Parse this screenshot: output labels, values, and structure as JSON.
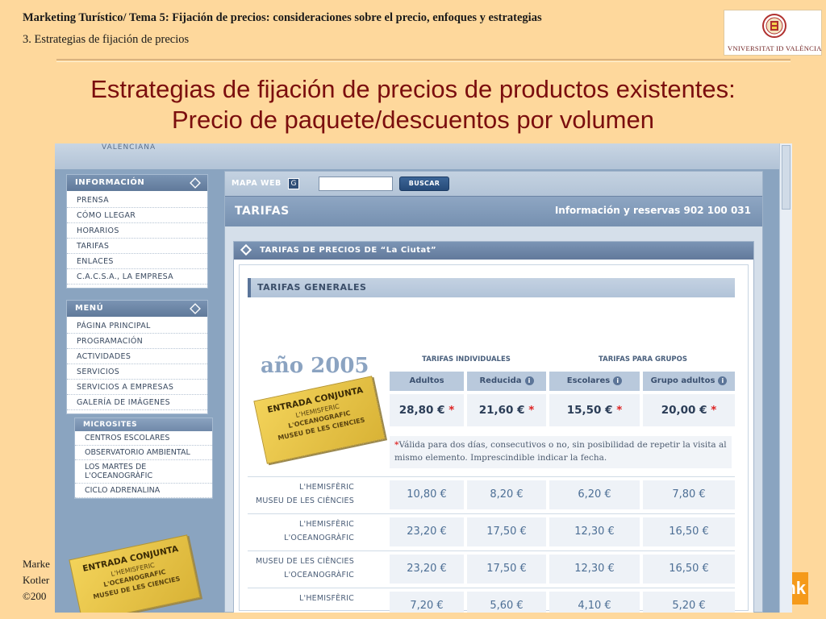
{
  "slide": {
    "header_line1": "Marketing Turístico/ Tema 5: Fijación de precios: consideraciones sobre el precio, enfoques y estrategias",
    "header_line2": "3.  Estrategias de fijación de precios",
    "title_line1": "Estrategias de fijación de precios de productos existentes:",
    "title_line2": "Precio de paquete/descuentos por volumen",
    "logo_text": "VNIVERSITAT ID VALÈNCIA",
    "footer_line1": "Marke",
    "footer_line2": "Kotler",
    "footer_line3": "©200",
    "footer_logo_text": "nk"
  },
  "website": {
    "banner_text": "VALENCIANA",
    "info_box": {
      "title": "INFORMACIÓN",
      "items": [
        "PRENSA",
        "CÓMO LLEGAR",
        "HORARIOS",
        "TARIFAS",
        "ENLACES",
        "C.A.C.S.A., LA EMPRESA"
      ]
    },
    "menu_box": {
      "title": "MENÚ",
      "items": [
        "PÁGINA PRINCIPAL",
        "PROGRAMACIÓN",
        "ACTIVIDADES",
        "SERVICIOS",
        "SERVICIOS A EMPRESAS",
        "GALERÍA DE IMÁGENES"
      ]
    },
    "microsites_box": {
      "title": "MICROSITES",
      "items": [
        "CENTROS ESCOLARES",
        "OBSERVATORIO AMBIENTAL",
        "LOS MARTES DE",
        "L'OCEANOGRÀFIC",
        "CICLO ADRENALINA"
      ]
    },
    "promo_ticket": {
      "title": "ENTRADA CONJUNTA",
      "line2": "L'HEMISFERIC",
      "line3": "L'OCEANOGRAFIC",
      "line4": "MUSEU DE LES CIENCIES"
    },
    "search": {
      "label": "MAPA WEB",
      "button": "BUSCAR",
      "value": ""
    },
    "tarifas_title": "TARIFAS",
    "reservas": "Información y reservas 902 100 031",
    "panel_title": "TARIFAS DE PRECIOS DE “La Ciutat”",
    "general_title": "TARIFAS GENERALES",
    "year": "año 2005",
    "ticket": {
      "title": "ENTRADA CONJUNTA",
      "line2": "L'HEMISFERIC",
      "line3": "L'OCEANOGRAFIC",
      "line4": "MUSEU DE LES CIENCIES"
    },
    "group_individual": "TARIFAS INDIVIDUALES",
    "group_groups": "TARIFAS PARA GRUPOS",
    "columns": [
      "Adultos",
      "Reducida",
      "Escolares",
      "Grupo adultos"
    ],
    "combo_prices": [
      "28,80 €",
      "21,60 €",
      "15,50 €",
      "20,00 €"
    ],
    "note": "Válida para dos días, consecutivos o no, sin posibilidad de repetir la visita al mismo elemento. Imprescindible indicar la fecha.",
    "rows": [
      {
        "line1": "L'HEMISFÈRIC",
        "line2": "MUSEU DE LES CIÈNCIES",
        "values": [
          "10,80 €",
          "8,20 €",
          "6,20 €",
          "7,80 €"
        ]
      },
      {
        "line1": "L'HEMISFÈRIC",
        "line2": "L'OCEANOGRÀFIC",
        "values": [
          "23,20 €",
          "17,50 €",
          "12,30 €",
          "16,50 €"
        ]
      },
      {
        "line1": "MUSEU DE LES CIÈNCIES",
        "line2": "L'OCEANOGRÀFIC",
        "values": [
          "23,20 €",
          "17,50 €",
          "12,30 €",
          "16,50 €"
        ]
      },
      {
        "line1": "L'HEMISFÈRIC",
        "line2": "",
        "values": [
          "7,20 €",
          "5,60 €",
          "4,10 €",
          "5,20 €"
        ]
      }
    ]
  },
  "colors": {
    "slide_bg": "#fed89c",
    "title": "#7b0e0e",
    "site_panel": "#8aa4c0",
    "price_text": "#2b3d57",
    "asterisk": "#dd2222"
  }
}
